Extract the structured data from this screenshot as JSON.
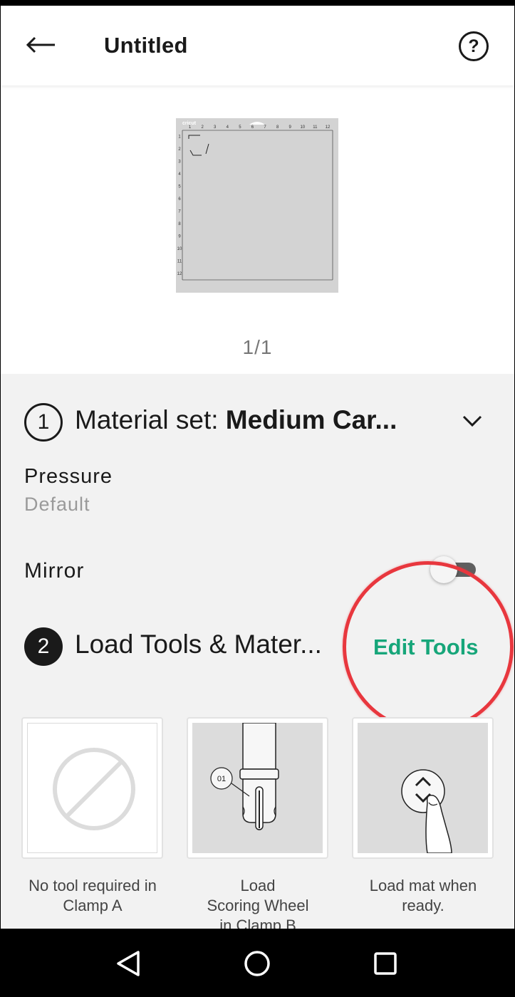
{
  "header": {
    "title": "Untitled",
    "back_icon": "arrow-left-icon",
    "help_label": "?"
  },
  "preview": {
    "mat_brand": "cricut",
    "ruler_top": [
      "1",
      "2",
      "3",
      "4",
      "5",
      "6",
      "7",
      "8",
      "9",
      "10",
      "11",
      "12"
    ],
    "ruler_left": [
      "1",
      "2",
      "3",
      "4",
      "5",
      "6",
      "7",
      "8",
      "9",
      "10",
      "11",
      "12"
    ],
    "page_count": "1/1"
  },
  "step1": {
    "number": "1",
    "label_prefix": "Material set: ",
    "material": "Medium Car..."
  },
  "settings": {
    "pressure_label": "Pressure",
    "pressure_value": "Default",
    "mirror_label": "Mirror",
    "mirror_on": false
  },
  "step2": {
    "number": "2",
    "label": "Load Tools & Mater...",
    "edit_tools_label": "Edit Tools"
  },
  "tool_cards": [
    {
      "icon": "no-tool-icon",
      "caption_lines": [
        "No tool required in",
        "Clamp A"
      ]
    },
    {
      "icon": "scoring-wheel-icon",
      "badge": "01",
      "caption_lines": [
        "Load",
        "Scoring Wheel",
        "in Clamp B"
      ]
    },
    {
      "icon": "load-mat-button-icon",
      "caption_lines": [
        "Load mat when",
        "ready."
      ]
    }
  ],
  "colors": {
    "accent": "#17a67a",
    "highlight": "#e8373e",
    "panel_bg": "#f2f2f2",
    "mat": "#d3d3d3"
  },
  "nav": {
    "back_icon": "triangle-back-icon",
    "home_icon": "circle-home-icon",
    "recent_icon": "square-recent-icon"
  }
}
